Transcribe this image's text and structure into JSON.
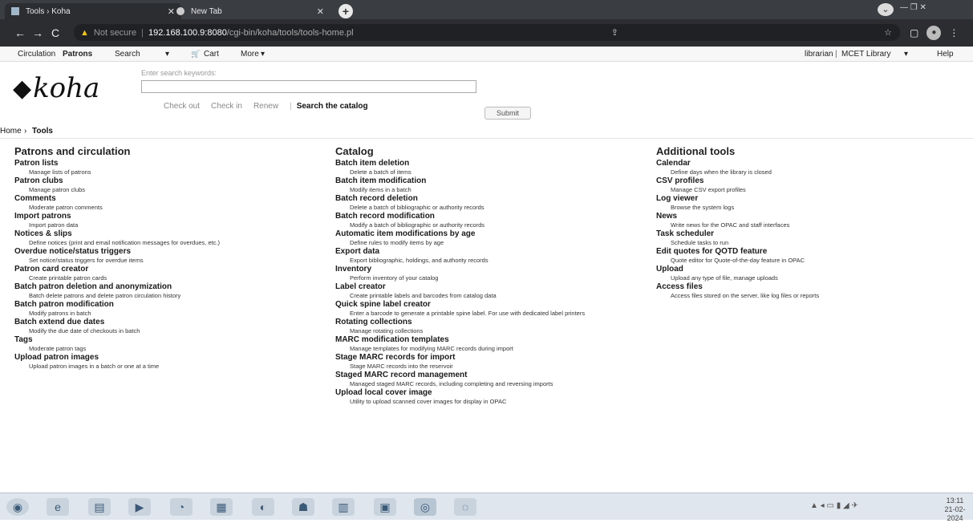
{
  "browser": {
    "tabs": [
      {
        "label": "Tools › Koha",
        "active": true
      },
      {
        "label": "New Tab",
        "active": false
      }
    ],
    "address": {
      "not_secure": "Not secure",
      "host": "192.168.100.9:8080",
      "path": "/cgi-bin/koha/tools/tools-home.pl"
    }
  },
  "koha_nav": {
    "circulation": "Circulation",
    "patrons": "Patrons",
    "search": "Search",
    "cart": "Cart",
    "more": "More",
    "user": "librarian",
    "library": "MCET Library",
    "help": "Help"
  },
  "logo": "koha",
  "search": {
    "hint": "Enter search keywords:",
    "value": "",
    "submit": "Submit",
    "tabs": [
      "Check out",
      "Check in",
      "Renew"
    ],
    "active_tab": "Search the catalog"
  },
  "breadcrumb": {
    "home": "Home",
    "sep": "›",
    "current": "Tools"
  },
  "columns": [
    {
      "heading": "Patrons and circulation",
      "items": [
        {
          "title": "Patron lists",
          "desc": "Manage lists of patrons"
        },
        {
          "title": "Patron clubs",
          "desc": "Manage patron clubs"
        },
        {
          "title": "Comments",
          "desc": "Moderate patron comments"
        },
        {
          "title": "Import patrons",
          "desc": "Import patron data"
        },
        {
          "title": "Notices & slips",
          "desc": "Define notices (print and email notification messages for overdues, etc.)"
        },
        {
          "title": "Overdue notice/status triggers",
          "desc": "Set notice/status triggers for overdue items"
        },
        {
          "title": "Patron card creator",
          "desc": "Create printable patron cards"
        },
        {
          "title": "Batch patron deletion and anonymization",
          "desc": "Batch delete patrons and delete patron circulation history"
        },
        {
          "title": "Batch patron modification",
          "desc": "Modify patrons in batch"
        },
        {
          "title": "Batch extend due dates",
          "desc": "Modify the due date of checkouts in batch"
        },
        {
          "title": "Tags",
          "desc": "Moderate patron tags"
        },
        {
          "title": "Upload patron images",
          "desc": "Upload patron images in a batch or one at a time"
        }
      ]
    },
    {
      "heading": "Catalog",
      "items": [
        {
          "title": "Batch item deletion",
          "desc": "Delete a batch of items"
        },
        {
          "title": "Batch item modification",
          "desc": "Modify items in a batch"
        },
        {
          "title": "Batch record deletion",
          "desc": "Delete a batch of bibliographic or authority records"
        },
        {
          "title": "Batch record modification",
          "desc": "Modify a batch of bibliographic or authority records"
        },
        {
          "title": "Automatic item modifications by age",
          "desc": "Define rules to modify items by age"
        },
        {
          "title": "Export data",
          "desc": "Export bibliographic, holdings, and authority records"
        },
        {
          "title": "Inventory",
          "desc": "Perform inventory of your catalog"
        },
        {
          "title": "Label creator",
          "desc": "Create printable labels and barcodes from catalog data"
        },
        {
          "title": "Quick spine label creator",
          "desc": "Enter a barcode to generate a printable spine label. For use with dedicated label printers"
        },
        {
          "title": "Rotating collections",
          "desc": "Manage rotating collections"
        },
        {
          "title": "MARC modification templates",
          "desc": "Manage templates for modifying MARC records during import"
        },
        {
          "title": "Stage MARC records for import",
          "desc": "Stage MARC records into the reservoir"
        },
        {
          "title": "Staged MARC record management",
          "desc": "Managed staged MARC records, including completing and reversing imports"
        },
        {
          "title": "Upload local cover image",
          "desc": "Utility to upload scanned cover images for display in OPAC"
        }
      ]
    },
    {
      "heading": "Additional tools",
      "items": [
        {
          "title": "Calendar",
          "desc": "Define days when the library is closed"
        },
        {
          "title": "CSV profiles",
          "desc": "Manage CSV export profiles"
        },
        {
          "title": "Log viewer",
          "desc": "Browse the system logs"
        },
        {
          "title": "News",
          "desc": "Write news for the OPAC and staff interfaces"
        },
        {
          "title": "Task scheduler",
          "desc": "Schedule tasks to run"
        },
        {
          "title": "Edit quotes for QOTD feature",
          "desc": "Quote editor for Quote-of-the-day feature in OPAC"
        },
        {
          "title": "Upload",
          "desc": "Upload any type of file, manage uploads"
        },
        {
          "title": "Access files",
          "desc": "Access files stored on the server, like log files or reports"
        }
      ]
    }
  ],
  "taskbar": {
    "clock_time": "13:11",
    "clock_date": "21-02-2024"
  }
}
